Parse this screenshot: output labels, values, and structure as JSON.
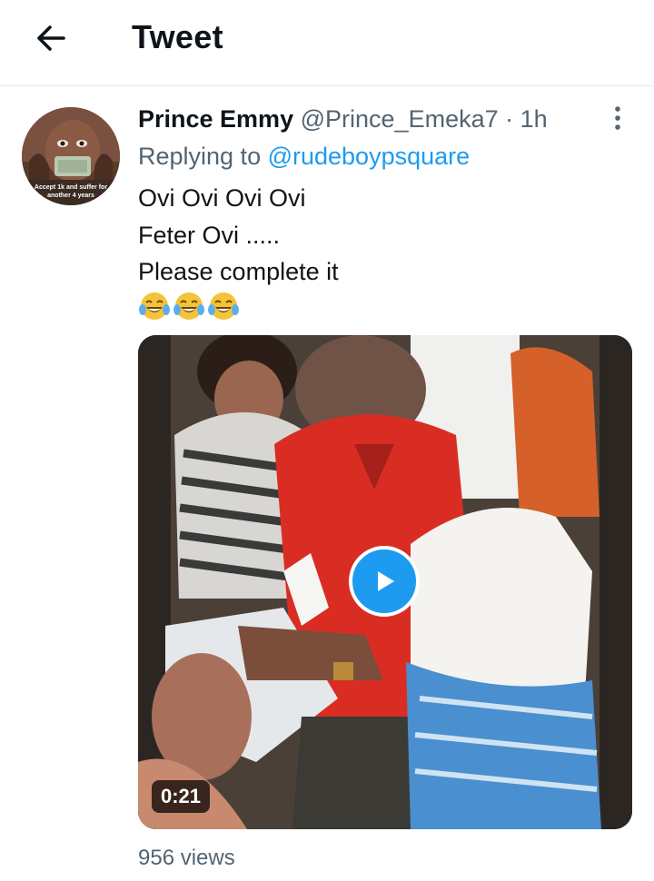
{
  "header": {
    "title": "Tweet",
    "back_icon": "arrow-left-icon"
  },
  "tweet": {
    "author_name": "Prince Emmy",
    "author_handle": "@Prince_Emeka7",
    "separator": "·",
    "time": "1h",
    "replying_prefix": "Replying to ",
    "replying_to": "@rudeboypsquare",
    "lines": [
      "Ovi Ovi Ovi Ovi",
      "Feter Ovi .....",
      "Please complete it"
    ],
    "emojis": [
      "😂",
      "😂",
      "😂"
    ],
    "avatar_caption": "Accept 1k and suffer for another 4 years",
    "video": {
      "duration": "0:21"
    },
    "views": "956 views"
  },
  "colors": {
    "accent": "#1d9bf0",
    "secondary_text": "#536471",
    "primary_text": "#0f1419"
  }
}
